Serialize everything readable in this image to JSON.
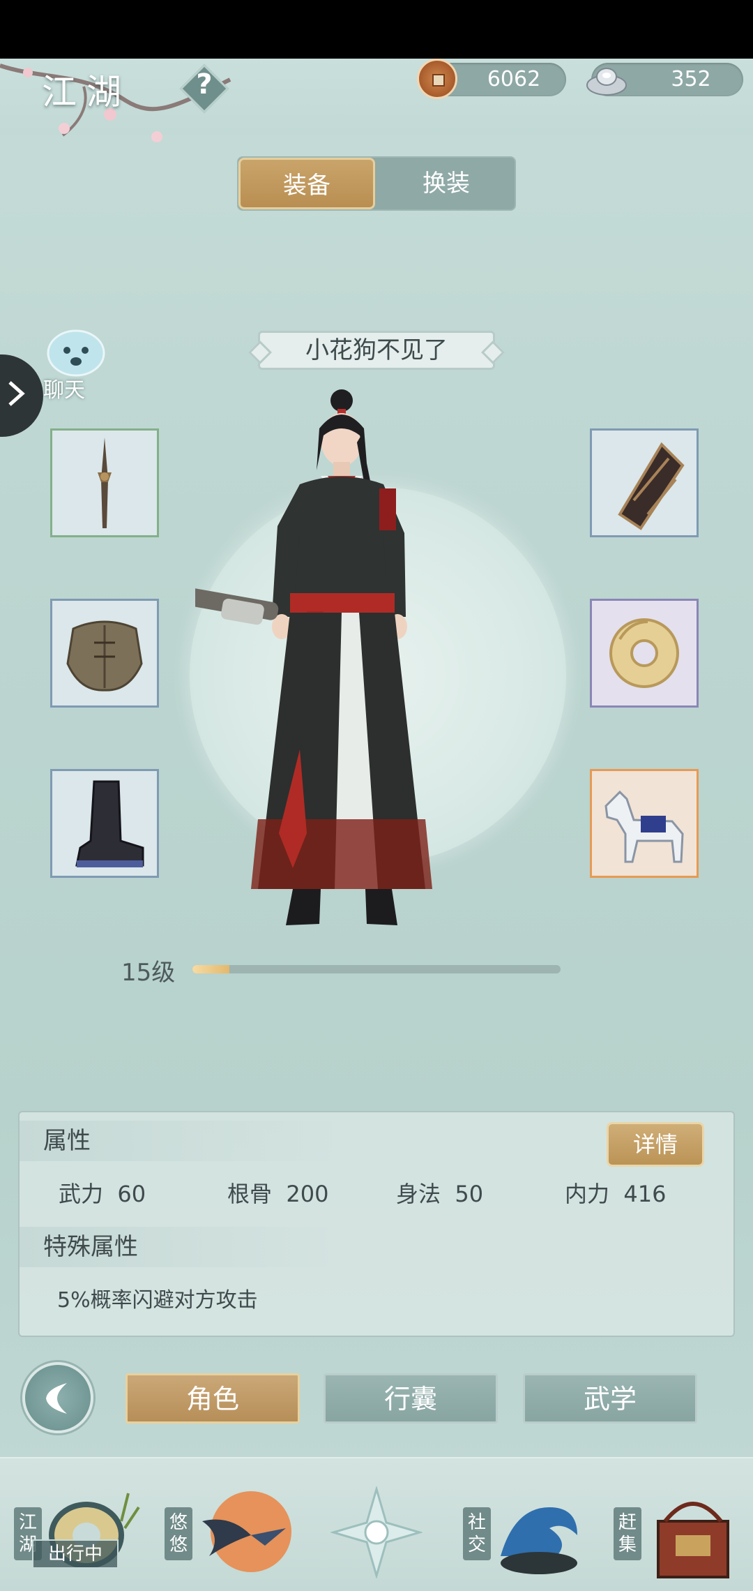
{
  "header": {
    "title": "江湖",
    "help_symbol": "?",
    "copper_coins": "6062",
    "silver_ingots": "352"
  },
  "tabs": {
    "equip": "装备",
    "change": "换装",
    "active": "装备"
  },
  "character": {
    "name": "小花狗不见了",
    "level_label": "15级",
    "level_progress": 0.1
  },
  "chat": {
    "label": "聊天"
  },
  "equipment": {
    "left": [
      "weapon-icon",
      "armor-icon",
      "boots-icon"
    ],
    "right": [
      "bracer-icon",
      "jade-pendant-icon",
      "horse-icon"
    ]
  },
  "attributes": {
    "title": "属性",
    "detail_button": "详情",
    "items": [
      {
        "name": "武力",
        "value": "60"
      },
      {
        "name": "根骨",
        "value": "200"
      },
      {
        "name": "身法",
        "value": "50"
      },
      {
        "name": "内力",
        "value": "416"
      }
    ],
    "special_title": "特殊属性",
    "special_text": "5%概率闪避对方攻击"
  },
  "subnav": {
    "role": "角色",
    "bag": "行囊",
    "martial": "武学",
    "active": "角色"
  },
  "bottom_nav": {
    "jianghu": "江湖",
    "jianghu_badge": "出行中",
    "youyou": "悠悠",
    "social": "社交",
    "market": "赶集"
  },
  "colors": {
    "gold": "#c2995d",
    "teal": "#8fa9a6",
    "background": "#c1d8d4"
  }
}
